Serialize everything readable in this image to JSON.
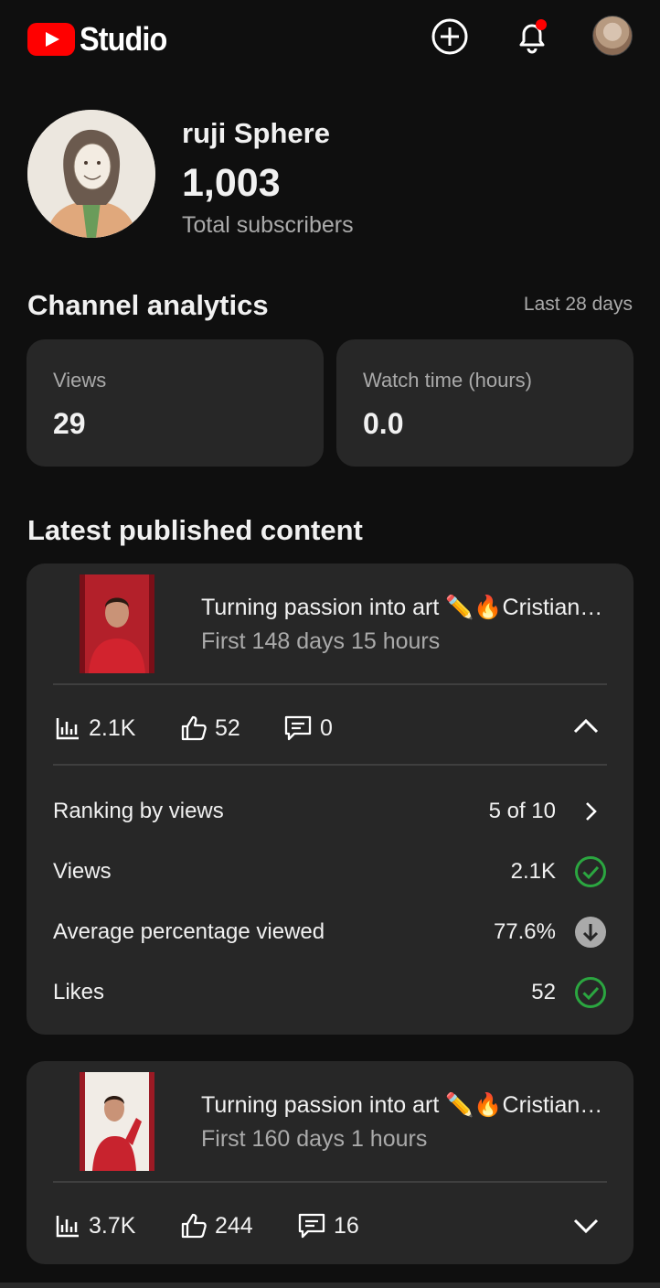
{
  "header": {
    "logo_text": "Studio",
    "icons": [
      "create-icon",
      "notifications-icon",
      "account-avatar"
    ],
    "notification_dot_color": "#ff0000"
  },
  "channel": {
    "name": "ruji Sphere",
    "subscribers": "1,003",
    "subscribers_label": "Total subscribers"
  },
  "analytics": {
    "title": "Channel analytics",
    "range": "Last 28 days",
    "cards": [
      {
        "label": "Views",
        "value": "29"
      },
      {
        "label": "Watch time (hours)",
        "value": "0.0"
      }
    ]
  },
  "latest": {
    "title": "Latest published content",
    "items": [
      {
        "title": "Turning passion into art ✏️🔥Cristiano Ronaldo",
        "subtitle": "First 148 days 15 hours",
        "views": "2.1K",
        "likes": "52",
        "comments": "0",
        "expanded": true,
        "details": [
          {
            "label": "Ranking by views",
            "value": "5 of 10",
            "icon": "chevron-right-icon"
          },
          {
            "label": "Views",
            "value": "2.1K",
            "icon": "check-circle-icon",
            "color": "#2ba640"
          },
          {
            "label": "Average percentage viewed",
            "value": "77.6%",
            "icon": "arrow-down-circle-icon",
            "color": "#aaaaaa"
          },
          {
            "label": "Likes",
            "value": "52",
            "icon": "check-circle-icon",
            "color": "#2ba640"
          }
        ]
      },
      {
        "title": "Turning passion into art ✏️🔥Cristiano Ronaldo",
        "subtitle": "First 160 days 1 hours",
        "views": "3.7K",
        "likes": "244",
        "comments": "16",
        "expanded": false
      }
    ]
  },
  "colors": {
    "background": "#0f0f0f",
    "card": "#272727",
    "accent_red": "#ff0000",
    "success_green": "#2ba640"
  }
}
